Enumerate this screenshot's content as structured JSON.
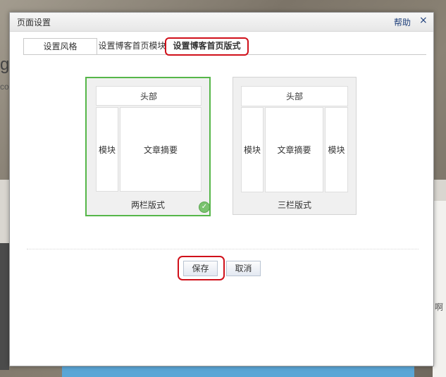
{
  "dialog": {
    "title": "页面设置",
    "help_label": "帮助",
    "close_glyph": "×"
  },
  "tabs": [
    {
      "label": "设置风格"
    },
    {
      "label": "设置博客首页模块"
    },
    {
      "label": "设置博客首页版式"
    }
  ],
  "layouts": [
    {
      "label": "两栏版式",
      "header": "头部",
      "left": "模块",
      "main": "文章摘要",
      "selected": true
    },
    {
      "label": "三栏版式",
      "header": "头部",
      "left": "模块",
      "main": "文章摘要",
      "right": "模块",
      "selected": false
    }
  ],
  "actions": {
    "save_label": "保存",
    "cancel_label": "取消"
  },
  "background": {
    "fragment_left_1": "g",
    "fragment_left_2": "co",
    "fragment_right": "啊"
  },
  "colors": {
    "selected_border": "#56b649",
    "highlight_ring": "#d0101a",
    "link": "#1e3f7a"
  }
}
